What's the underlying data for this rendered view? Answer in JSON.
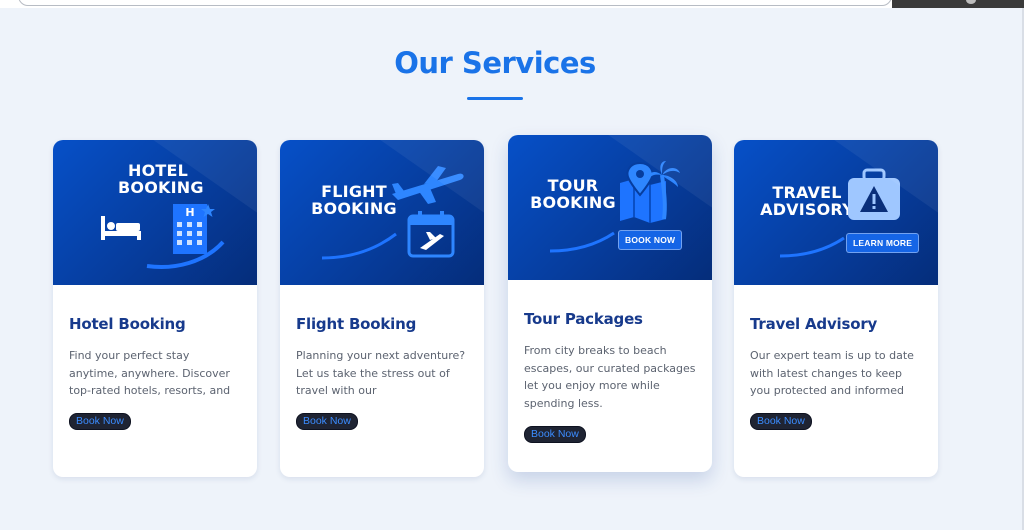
{
  "section": {
    "title": "Our Services"
  },
  "cards": [
    {
      "banner_lines": [
        "HOTEL",
        "BOOKING"
      ],
      "title": "Hotel Booking",
      "description": "Find your perfect stay anytime, anywhere. Discover top-rated hotels, resorts, and",
      "button": "Book Now",
      "icons": [
        "bed-icon",
        "hotel-building-icon",
        "star-icon"
      ]
    },
    {
      "banner_lines": [
        "FLIGHT",
        "BOOKING"
      ],
      "title": "Flight Booking",
      "description": "Planning your next adventure? Let us take the stress out of travel with our",
      "button": "Book Now",
      "icons": [
        "airplane-icon",
        "calendar-flight-icon"
      ]
    },
    {
      "banner_lines": [
        "TOUR",
        "BOOKING"
      ],
      "banner_button": "BOOK NOW",
      "title": "Tour Packages",
      "description": "From city breaks to beach escapes, our curated packages let you enjoy more while spending less.",
      "button": "Book Now",
      "icons": [
        "map-pin-icon",
        "palm-tree-icon"
      ]
    },
    {
      "banner_lines": [
        "TRAVEL",
        "ADVISORY"
      ],
      "banner_button": "LEARN MORE",
      "title": "Travel Advisory",
      "description": "Our expert team is up to date with latest changes to keep you protected and informed",
      "button": "Book Now",
      "icons": [
        "suitcase-warning-icon"
      ]
    }
  ],
  "colors": {
    "accent": "#1a73e8",
    "banner_dark": "#052d7a",
    "banner_light": "#0650c8",
    "card_title": "#173a8c",
    "page_bg": "#eef3fa"
  }
}
